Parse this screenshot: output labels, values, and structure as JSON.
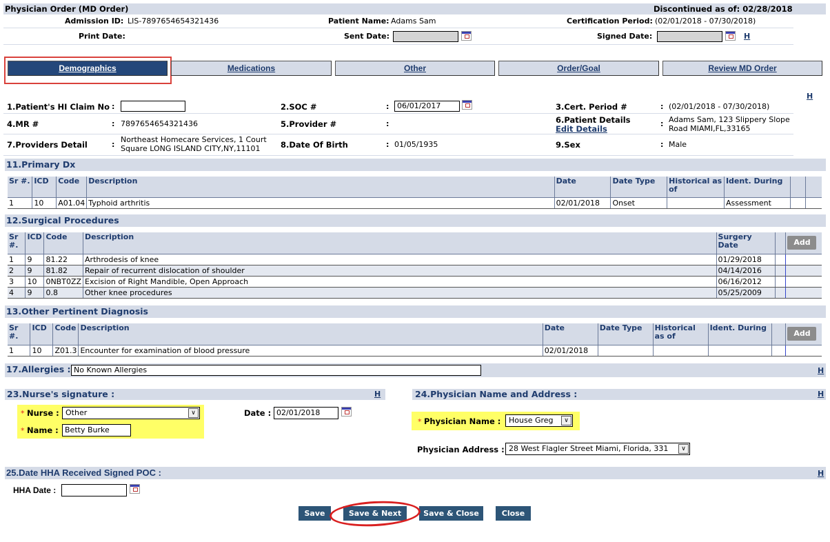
{
  "header": {
    "title": "Physician Order (MD Order)",
    "discontinued": "Discontinued as of: 02/28/2018",
    "admission_id_label": "Admission ID:",
    "admission_id": "LIS-7897654654321436",
    "patient_name_label": "Patient Name:",
    "patient_name": "Adams Sam",
    "cert_period_label": "Certification Period:",
    "cert_period": "(02/01/2018 - 07/30/2018)",
    "print_date_label": "Print Date:",
    "sent_date_label": "Sent Date:",
    "sent_date_value": "",
    "signed_date_label": "Signed Date:",
    "signed_date_value": "",
    "help_link": "H"
  },
  "tabs": [
    {
      "label": "Demographics",
      "active": true
    },
    {
      "label": "Medications"
    },
    {
      "label": "Other"
    },
    {
      "label": "Order/Goal"
    },
    {
      "label": "Review MD Order"
    }
  ],
  "demographics": {
    "help_link": "H",
    "claim_label": "1.Patient's HI Claim No",
    "claim_value": "",
    "soc_label": "2.SOC #",
    "soc_value": "06/01/2017",
    "cert_label": "3.Cert. Period #",
    "cert_value": "(02/01/2018 - 07/30/2018)",
    "mr_label": "4.MR #",
    "mr_value": "7897654654321436",
    "provider_label": "5.Provider #",
    "provider_value": "",
    "patient_details_label": "6.Patient Details",
    "edit_details": "Edit Details",
    "patient_details_line1": "Adams Sam, 123 Slippery Slope",
    "patient_details_line2": "Road MIAMI,FL,33165",
    "providers_detail_label": "7.Providers Detail",
    "providers_detail_line1": "Northeast Homecare Services, 1 Court",
    "providers_detail_line2": "Square LONG ISLAND CITY,NY,11101",
    "dob_label": "8.Date Of Birth",
    "dob_value": "01/05/1935",
    "sex_label": "9.Sex",
    "sex_value": "Male",
    "colon": ":"
  },
  "primary_dx": {
    "title": "11.Primary Dx",
    "columns": [
      "Sr #.",
      "ICD",
      "Code",
      "Description",
      "Date",
      "Date Type",
      "Historical as of",
      "Ident. During",
      "",
      ""
    ],
    "rows": [
      [
        "1",
        "10",
        "A01.04",
        "Typhoid arthritis",
        "02/01/2018",
        "Onset",
        "",
        "Assessment",
        "",
        ""
      ]
    ]
  },
  "surgical": {
    "title": "12.Surgical Procedures",
    "columns": [
      "Sr #.",
      "ICD",
      "Code",
      "Description",
      "Surgery Date",
      ""
    ],
    "add_label": "Add",
    "rows": [
      [
        "1",
        "9",
        "81.22",
        "Arthrodesis of knee",
        "01/29/2018"
      ],
      [
        "2",
        "9",
        "81.82",
        "Repair of recurrent dislocation of shoulder",
        "04/14/2016"
      ],
      [
        "3",
        "10",
        "0NBT0ZZ",
        "Excision of Right Mandible, Open Approach",
        "06/16/2012"
      ],
      [
        "4",
        "9",
        "0.8",
        "Other knee procedures",
        "05/25/2009"
      ]
    ]
  },
  "other_dx": {
    "title": "13.Other Pertinent Diagnosis",
    "columns": [
      "Sr #.",
      "ICD",
      "Code",
      "Description",
      "Date",
      "Date Type",
      "Historical as of",
      "Ident. During",
      ""
    ],
    "add_label": "Add",
    "rows": [
      [
        "1",
        "10",
        "Z01.3",
        "Encounter for examination of blood pressure",
        "02/01/2018",
        "",
        "",
        ""
      ]
    ]
  },
  "allergies": {
    "label": "17.Allergies :",
    "value": "No Known Allergies",
    "help_link": "H"
  },
  "nurse": {
    "title": "23.Nurse's signature :",
    "help_link": "H",
    "required": "*",
    "nurse_label": "Nurse :",
    "nurse_value": "Other",
    "name_label": "Name :",
    "name_value": "Betty Burke",
    "date_label": "Date :",
    "date_value": "02/01/2018"
  },
  "physician": {
    "title": "24.Physician Name and Address :",
    "help_link": "H",
    "required": "*",
    "name_label": "Physician Name :",
    "name_value": "House Greg",
    "address_label": "Physician Address :",
    "address_value": "28 West Flagler Street Miami, Florida, 331"
  },
  "hha": {
    "title": "25.Date HHA Received Signed POC :",
    "help_link": "H",
    "date_label": "HHA Date :",
    "date_value": ""
  },
  "buttons": {
    "save": "Save",
    "save_next": "Save & Next",
    "save_close": "Save & Close",
    "close": "Close"
  },
  "colors": {
    "header_band": "#d5dbe7",
    "active_tab": "#24477a",
    "button": "#2d5577",
    "highlight": "#ffff66",
    "annotation_red": "#d9413b"
  }
}
